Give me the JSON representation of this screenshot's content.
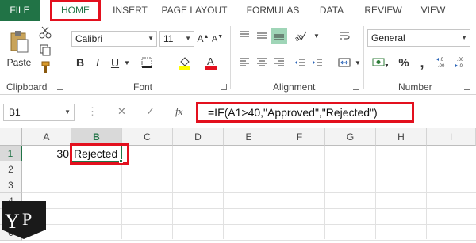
{
  "tabs": [
    {
      "label": "FILE"
    },
    {
      "label": "HOME"
    },
    {
      "label": "INSERT"
    },
    {
      "label": "PAGE LAYOUT"
    },
    {
      "label": "FORMULAS"
    },
    {
      "label": "DATA"
    },
    {
      "label": "REVIEW"
    },
    {
      "label": "VIEW"
    }
  ],
  "ribbon": {
    "clipboard": {
      "paste_label": "Paste",
      "group_label": "Clipboard"
    },
    "font": {
      "font_name": "Calibri",
      "font_size": "11",
      "group_label": "Font",
      "highlight_color": "#ffff00",
      "font_color": "#e3101e"
    },
    "alignment": {
      "group_label": "Alignment"
    },
    "number": {
      "format": "General",
      "group_label": "Number",
      "percent_label": "%"
    }
  },
  "formula_bar": {
    "name_box": "B1",
    "fx_label": "fx",
    "formula": "=IF(A1>40,\"Approved\",\"Rejected\")"
  },
  "grid": {
    "columns": [
      "A",
      "B",
      "C",
      "D",
      "E",
      "F",
      "G",
      "H",
      "I"
    ],
    "rows": [
      "1",
      "2",
      "3",
      "4",
      "5",
      "6"
    ],
    "cells": {
      "A1": "30",
      "B1": "Rejected"
    }
  },
  "colors": {
    "accent": "#217346",
    "highlight_box": "#e3101e"
  }
}
